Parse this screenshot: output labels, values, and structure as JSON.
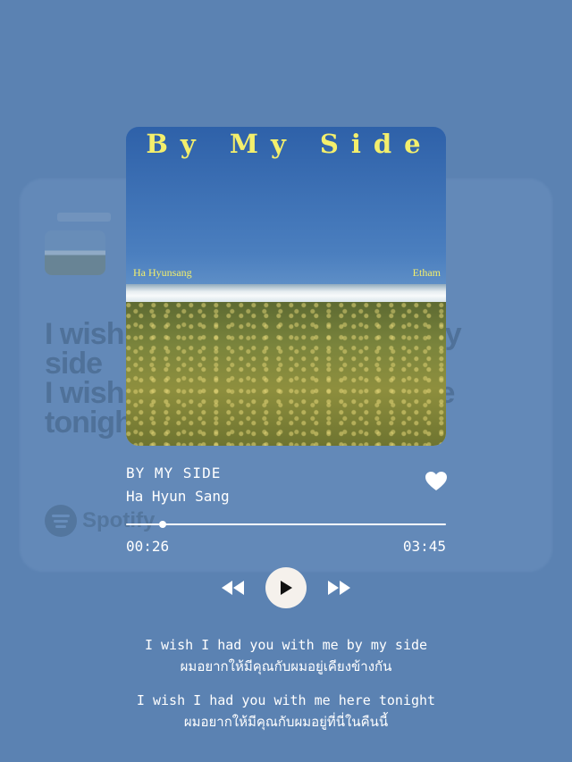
{
  "background_card": {
    "lyrics": [
      "I wish",
      "side",
      "I wish",
      "tonigh",
      "my",
      "e"
    ],
    "brand": "Spotify"
  },
  "album": {
    "title": "By My Side",
    "artist_left": "Ha Hyunsang",
    "artist_right": "Etham"
  },
  "track": {
    "title": "BY MY SIDE",
    "artist": "Ha Hyun Sang",
    "liked": true
  },
  "player": {
    "current_time": "00:26",
    "total_time": "03:45",
    "progress": 0.115
  },
  "controls": {
    "prev_icon": "rewind-icon",
    "play_icon": "play-icon",
    "next_icon": "fast-forward-icon"
  },
  "lyrics": [
    {
      "en": "I wish I had you with me by my side",
      "th": "ผมอยากให้มีคุณกับผมอยู่เคียงข้างกัน"
    },
    {
      "en": "I wish I had you with me here tonight",
      "th": "ผมอยากให้มีคุณกับผมอยู่ที่นี่ในคืนนี้"
    }
  ],
  "colors": {
    "background": "#5b82b2",
    "cover_text": "#f4ef6c",
    "play_button": "#f5f1ec",
    "text": "#ffffff"
  }
}
